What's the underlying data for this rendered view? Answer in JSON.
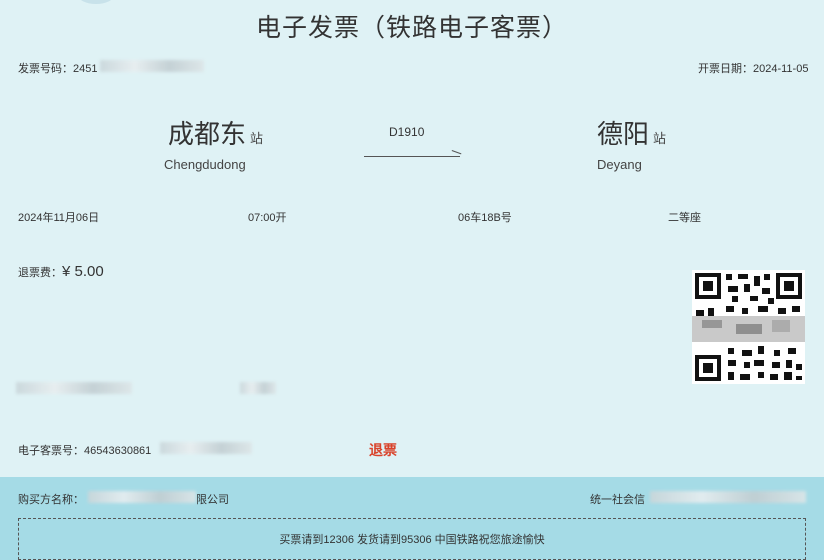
{
  "title": "电子发票（铁路电子客票）",
  "invoice_number_label": "发票号码：",
  "invoice_number_visible": "2451",
  "invoice_number_tail": "1",
  "issue_date_label": "开票日期：",
  "issue_date": "2024-11-05",
  "departure": {
    "name": "成都东",
    "suffix": "站",
    "pinyin": "Chengdudong"
  },
  "arrival": {
    "name": "德阳",
    "suffix": "站",
    "pinyin": "Deyang"
  },
  "train_number": "D1910",
  "travel_date": "2024年11月06日",
  "departure_time": "07:00开",
  "seat": "06车18B号",
  "seat_class": "二等座",
  "refund_fee_label": "退票费：",
  "refund_fee_value": "¥ 5.00",
  "eticket_label": "电子客票号：",
  "eticket_number": "46543630861",
  "eticket_number_partial": "1",
  "refund_mark": "退票",
  "buyer_label": "购买方名称：",
  "buyer_suffix": "限公司",
  "credit_label": "统一社会信",
  "slogan": "买票请到12306 发货请到95306 中国铁路祝您旅途愉快"
}
